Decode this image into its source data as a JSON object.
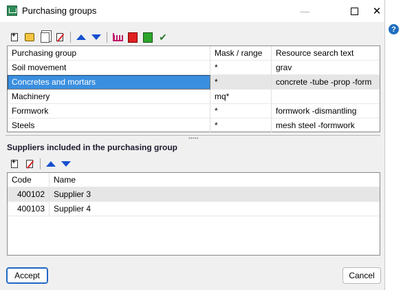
{
  "window": {
    "title": "Purchasing groups"
  },
  "groups_table": {
    "columns": [
      "Purchasing group",
      "Mask / range",
      "Resource search text"
    ],
    "rows": [
      [
        "Soil movement",
        "*",
        "grav"
      ],
      [
        "Concretes and mortars",
        "*",
        "concrete -tube -prop -form"
      ],
      [
        "Machinery",
        "mq*",
        ""
      ],
      [
        "Formwork",
        "*",
        "formwork -dismantling"
      ],
      [
        "Steels",
        "*",
        "mesh steel -formwork"
      ]
    ],
    "selected_row": 1
  },
  "suppliers": {
    "heading": "Suppliers included in the purchasing group",
    "columns": [
      "Code",
      "Name"
    ],
    "rows": [
      [
        "400102",
        "Supplier 3"
      ],
      [
        "400103",
        "Supplier 4"
      ]
    ],
    "selected_row": 0
  },
  "footer": {
    "accept_label": "Accept",
    "cancel_label": "Cancel"
  },
  "icons": {
    "titlebar_controls": [
      "minimize-icon",
      "maximize-icon",
      "close-icon"
    ],
    "top_toolbar": [
      "add-icon",
      "edit-icon",
      "copy-icon",
      "delete-icon",
      "move-up-icon",
      "move-down-icon",
      "chart-icon",
      "export-icon",
      "import-icon",
      "check-icon"
    ],
    "supplier_toolbar": [
      "add-icon",
      "delete-icon",
      "move-up-icon",
      "move-down-icon"
    ]
  }
}
